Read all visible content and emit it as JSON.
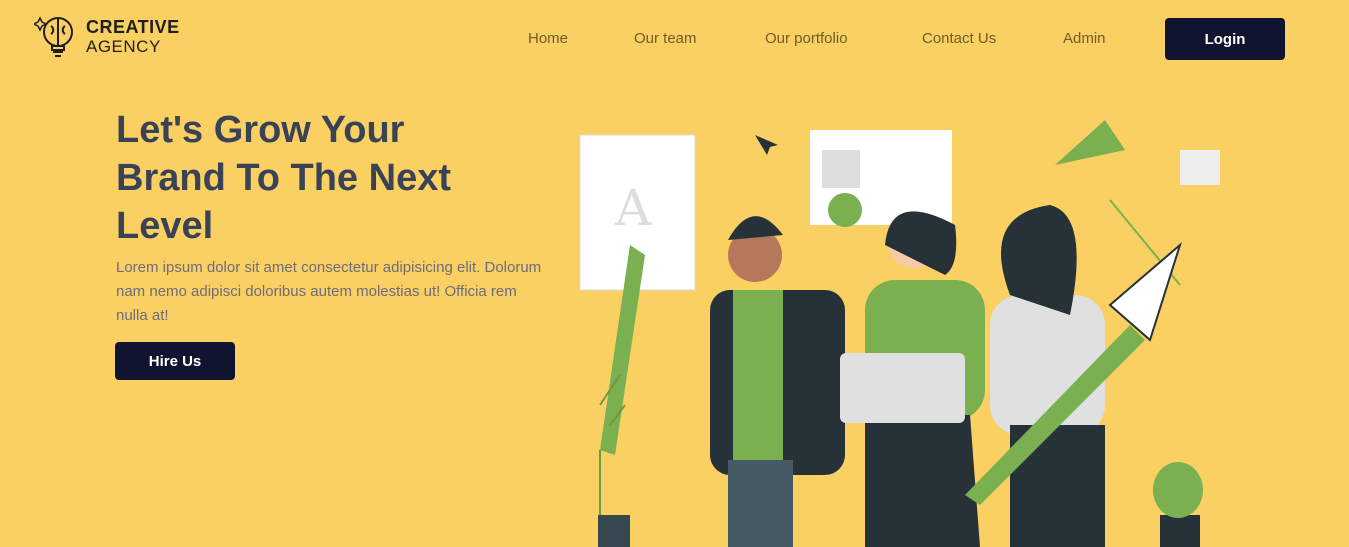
{
  "logo": {
    "line1": "CREATIVE",
    "line2": "AGENCY"
  },
  "nav": {
    "items": [
      "Home",
      "Our team",
      "Our portfolio",
      "Contact Us",
      "Admin"
    ],
    "login": "Login"
  },
  "hero": {
    "title": "Let's Grow Your Brand To The Next Level",
    "description": "Lorem ipsum dolor sit amet consectetur adipisicing elit. Dolorum nam nemo adipisci doloribus autem molestias ut! Officia rem nulla at!",
    "cta": "Hire Us"
  },
  "colors": {
    "background": "#fbd062",
    "button": "#111430",
    "accent": "#7ab04f"
  }
}
